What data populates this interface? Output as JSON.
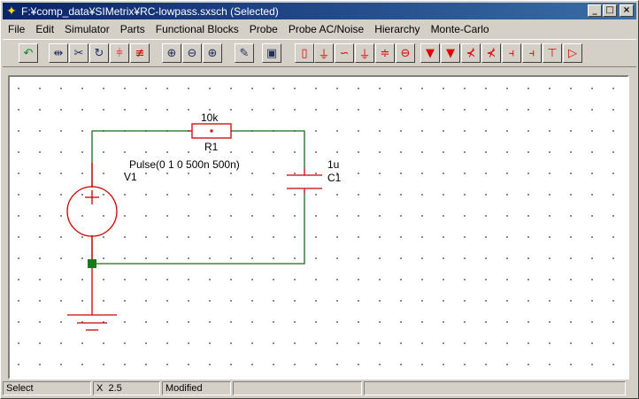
{
  "window": {
    "title": "F:¥comp_data¥SIMetrix¥RC-lowpass.sxsch (Selected)",
    "buttons": {
      "minimize": "_",
      "maximize": "□",
      "close": "×"
    }
  },
  "menu": [
    {
      "id": "file",
      "label": "File"
    },
    {
      "id": "edit",
      "label": "Edit"
    },
    {
      "id": "simulator",
      "label": "Simulator"
    },
    {
      "id": "parts",
      "label": "Parts"
    },
    {
      "id": "functional-blocks",
      "label": "Functional Blocks"
    },
    {
      "id": "probe",
      "label": "Probe"
    },
    {
      "id": "probe-ac-noise",
      "label": "Probe AC/Noise"
    },
    {
      "id": "hierarchy",
      "label": "Hierarchy"
    },
    {
      "id": "monte-carlo",
      "label": "Monte-Carlo"
    }
  ],
  "toolbar": [
    {
      "name": "undo-icon",
      "glyph": "↶",
      "color": "green"
    },
    {
      "name": "mirror-icon",
      "glyph": "⇹",
      "color": "dark"
    },
    {
      "name": "cut-icon",
      "glyph": "✂",
      "color": "dark"
    },
    {
      "name": "rotate-icon",
      "glyph": "↻",
      "color": "dark"
    },
    {
      "name": "delete-wire-icon",
      "glyph": "⫩",
      "color": "red"
    },
    {
      "name": "bus-icon",
      "glyph": "≢",
      "color": "red"
    },
    {
      "name": "zoom-fit-icon",
      "glyph": "⊕",
      "color": "dark"
    },
    {
      "name": "zoom-out-icon",
      "glyph": "⊖",
      "color": "dark"
    },
    {
      "name": "zoom-in-icon",
      "glyph": "⊕",
      "color": "dark"
    },
    {
      "name": "pencil-icon",
      "glyph": "✎",
      "color": "dark"
    },
    {
      "name": "run-icon",
      "glyph": "▣",
      "color": "dark"
    },
    {
      "name": "resistor-icon",
      "glyph": "▯",
      "color": "red"
    },
    {
      "name": "capacitor-icon",
      "glyph": "⏚",
      "color": "red"
    },
    {
      "name": "inductor-icon",
      "glyph": "∽",
      "color": "red"
    },
    {
      "name": "ground-icon",
      "glyph": "⏚",
      "color": "red"
    },
    {
      "name": "battery-icon",
      "glyph": "≑",
      "color": "red"
    },
    {
      "name": "source-icon",
      "glyph": "⊖",
      "color": "red"
    },
    {
      "name": "diode-icon",
      "glyph": "▼",
      "color": "red"
    },
    {
      "name": "zener-icon",
      "glyph": "▼",
      "color": "red"
    },
    {
      "name": "npn-icon",
      "glyph": "⊀",
      "color": "red"
    },
    {
      "name": "pnp-icon",
      "glyph": "⊀",
      "color": "red"
    },
    {
      "name": "nmos-icon",
      "glyph": "⫞",
      "color": "red"
    },
    {
      "name": "pmos-icon",
      "glyph": "⫞",
      "color": "red"
    },
    {
      "name": "njfet-icon",
      "glyph": "⊤",
      "color": "red"
    },
    {
      "name": "opamp-icon",
      "glyph": "▷",
      "color": "red"
    }
  ],
  "schematic": {
    "resistor": {
      "ref": "R1",
      "value": "10k"
    },
    "capacitor": {
      "ref": "C1",
      "value": "1u"
    },
    "source": {
      "ref": "V1",
      "value": "Pulse(0 1  0 500n 500n)"
    },
    "colors": {
      "wire": "#1a6a1a",
      "component": "#cc0000",
      "junction": "#1a7a1a"
    }
  },
  "status": {
    "mode": "Select",
    "coord_label": "X",
    "coord_value": "2.5",
    "state": "Modified"
  }
}
